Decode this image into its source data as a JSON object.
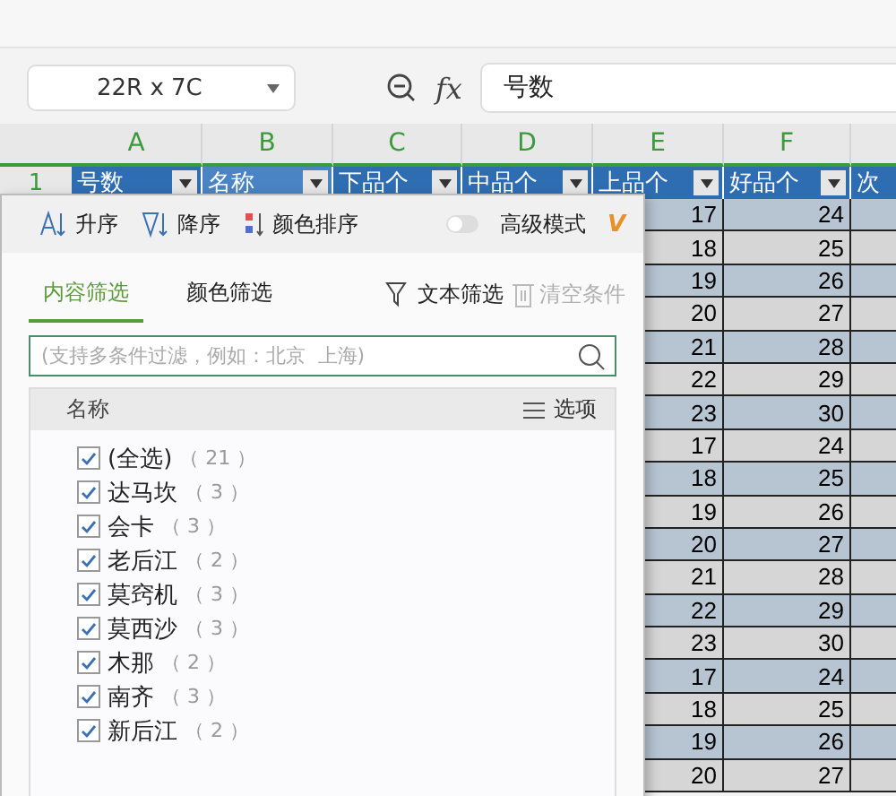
{
  "name_box": {
    "value": "22R x 7C"
  },
  "formula_bar": {
    "fx": "fx",
    "value": "号数"
  },
  "sheet": {
    "columns": [
      "A",
      "B",
      "C",
      "D",
      "E",
      "F"
    ],
    "row_number": "1",
    "headers": [
      {
        "text": "号数",
        "selected": true
      },
      {
        "text": "名称",
        "selected": false
      },
      {
        "text": "下品个",
        "selected": true
      },
      {
        "text": "中品个",
        "selected": true
      },
      {
        "text": "上品个",
        "selected": true
      },
      {
        "text": "好品个",
        "selected": true
      },
      {
        "text": "次",
        "selected": true
      }
    ],
    "rows": [
      [
        "17",
        "24"
      ],
      [
        "18",
        "25"
      ],
      [
        "19",
        "26"
      ],
      [
        "20",
        "27"
      ],
      [
        "21",
        "28"
      ],
      [
        "22",
        "29"
      ],
      [
        "23",
        "30"
      ],
      [
        "17",
        "24"
      ],
      [
        "18",
        "25"
      ],
      [
        "19",
        "26"
      ],
      [
        "20",
        "27"
      ],
      [
        "21",
        "28"
      ],
      [
        "22",
        "29"
      ],
      [
        "23",
        "30"
      ],
      [
        "17",
        "24"
      ],
      [
        "18",
        "25"
      ],
      [
        "19",
        "26"
      ],
      [
        "20",
        "27"
      ]
    ]
  },
  "filter_panel": {
    "sort_buttons": [
      {
        "kind": "asc",
        "label": "升序"
      },
      {
        "kind": "desc",
        "label": "降序"
      },
      {
        "kind": "color",
        "label": "颜色排序"
      }
    ],
    "advanced": {
      "label": "高级模式",
      "on": false,
      "badge": "V"
    },
    "tabs": [
      {
        "label": "内容筛选",
        "selected": true
      },
      {
        "label": "颜色筛选",
        "selected": false
      }
    ],
    "text_filter": {
      "label": "文本筛选",
      "disabled": false
    },
    "clear": {
      "label": "清空条件",
      "disabled": true
    },
    "search": {
      "placeholder": "(支持多条件过滤，例如：北京  上海)"
    },
    "list_header": {
      "title": "名称",
      "options": "选项"
    },
    "items": [
      {
        "name": "(全选)",
        "count": "（ 21 ）",
        "checked": true
      },
      {
        "name": "达马坎",
        "count": "（ 3 ）",
        "checked": true
      },
      {
        "name": "会卡",
        "count": "（ 3 ）",
        "checked": true
      },
      {
        "name": "老后江",
        "count": "（ 2 ）",
        "checked": true
      },
      {
        "name": "莫窍机",
        "count": "（ 3 ）",
        "checked": true
      },
      {
        "name": "莫西沙",
        "count": "（ 3 ）",
        "checked": true
      },
      {
        "name": "木那",
        "count": "（ 2 ）",
        "checked": true
      },
      {
        "name": "南齐",
        "count": "（ 3 ）",
        "checked": true
      },
      {
        "name": "新后江",
        "count": "（ 2 ）",
        "checked": true
      }
    ]
  }
}
